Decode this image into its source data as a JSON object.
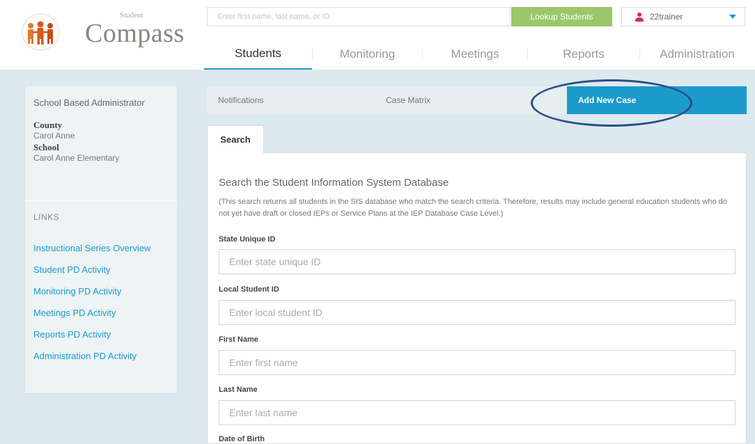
{
  "app": {
    "logo_small": "Student",
    "logo_main": "Compass"
  },
  "header": {
    "search_placeholder": "Enter first name, last name, or ID",
    "lookup_label": "Lookup Students",
    "username": "22trainer"
  },
  "main_nav": {
    "tabs": [
      {
        "label": "Students",
        "active": true
      },
      {
        "label": "Monitoring",
        "active": false
      },
      {
        "label": "Meetings",
        "active": false
      },
      {
        "label": "Reports",
        "active": false
      },
      {
        "label": "Administration",
        "active": false
      }
    ]
  },
  "sidebar": {
    "role": "School Based Administrator",
    "county_label": "County",
    "county_value": "Carol Anne",
    "school_label": "School",
    "school_value": "Carol Anne Elementary",
    "links_header": "LINKS",
    "links": [
      "Instructional Series Overview",
      "Student PD Activity",
      "Monitoring PD Activity",
      "Meetings PD Activity",
      "Reports PD Activity",
      "Administration PD Activity"
    ]
  },
  "subtabs": {
    "notifications": "Notifications",
    "case_matrix": "Case Matrix",
    "add_new_case": "Add New Case"
  },
  "search": {
    "tab_label": "Search",
    "title": "Search the Student Information System Database",
    "description": "(This search returns all students in the SIS database who match the search criteria. Therefore, results may include general education students who do not yet have draft or closed IEPs or Service Plans at the IEP Database Case Level.)",
    "fields": [
      {
        "label": "State Unique ID",
        "placeholder": "Enter state unique ID"
      },
      {
        "label": "Local Student ID",
        "placeholder": "Enter local student ID"
      },
      {
        "label": "First Name",
        "placeholder": "Enter first name"
      },
      {
        "label": "Last Name",
        "placeholder": "Enter last name"
      },
      {
        "label": "Date of Birth"
      }
    ]
  },
  "colors": {
    "accent": "#1a9bcc",
    "lookup_green": "#9bc76c",
    "annotation_circle": "#2c4d87",
    "page_bg": "#dce9ee"
  }
}
